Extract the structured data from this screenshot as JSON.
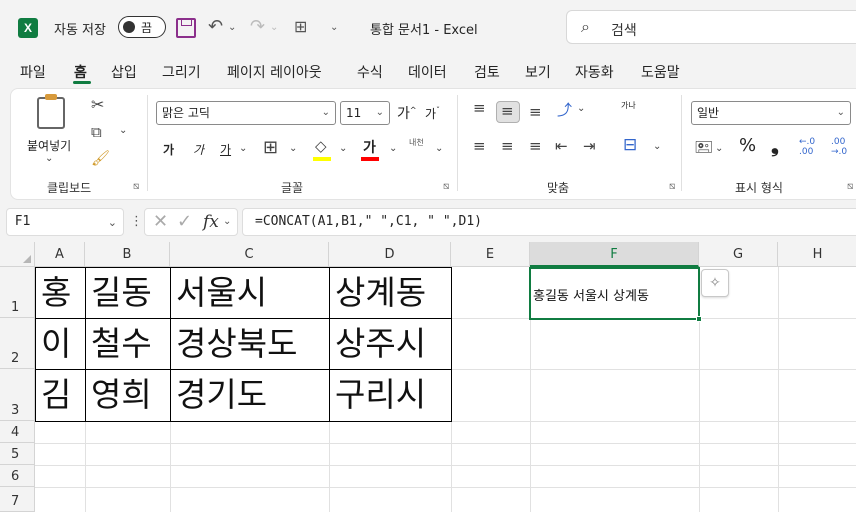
{
  "titlebar": {
    "logo_letter": "X",
    "autosave_label": "자동 저장",
    "autosave_state": "끔",
    "doc_title": "통합 문서1  -  Excel",
    "search_placeholder": "검색"
  },
  "menu": {
    "tabs": [
      "파일",
      "홈",
      "삽입",
      "그리기",
      "페이지 레이아웃",
      "수식",
      "데이터",
      "검토",
      "보기",
      "자동화",
      "도움말"
    ],
    "active_tab": "홈"
  },
  "ribbon": {
    "clipboard": {
      "paste_label": "붙여넣기",
      "group_label": "클립보드"
    },
    "font": {
      "font_name": "맑은 고딕",
      "font_size": "11",
      "grow": "가",
      "shrink": "가",
      "bold": "가",
      "italic": "가",
      "underline": "가",
      "color_a": "가",
      "phonetic": "내천",
      "group_label": "글꼴"
    },
    "alignment": {
      "wrap_icon": "가나",
      "group_label": "맞춤"
    },
    "number": {
      "format": "일반",
      "percent": "%",
      "comma": "❟",
      "inc_decimal": "←.0 .00",
      "dec_decimal": ".00 →.0",
      "group_label": "표시 형식"
    }
  },
  "formula_bar": {
    "name_box": "F1",
    "formula": "=CONCAT(A1,B1,\" \",C1, \" \",D1)"
  },
  "grid": {
    "columns": [
      "A",
      "B",
      "C",
      "D",
      "E",
      "F",
      "G",
      "H"
    ],
    "rows": [
      "1",
      "2",
      "3",
      "4",
      "5",
      "6",
      "7"
    ],
    "data": [
      [
        "홍",
        "길동",
        "서울시",
        "상계동"
      ],
      [
        "이",
        "철수",
        "경상북도",
        "상주시"
      ],
      [
        "김",
        "영희",
        "경기도",
        "구리시"
      ]
    ],
    "f1_value": "홍길동 서울시 상계동",
    "selected_column": "F"
  },
  "colors": {
    "accent": "#107c41",
    "save_icon": "#8b2f8b",
    "highlight_yellow": "#ffff00",
    "font_red": "#ff0000"
  }
}
